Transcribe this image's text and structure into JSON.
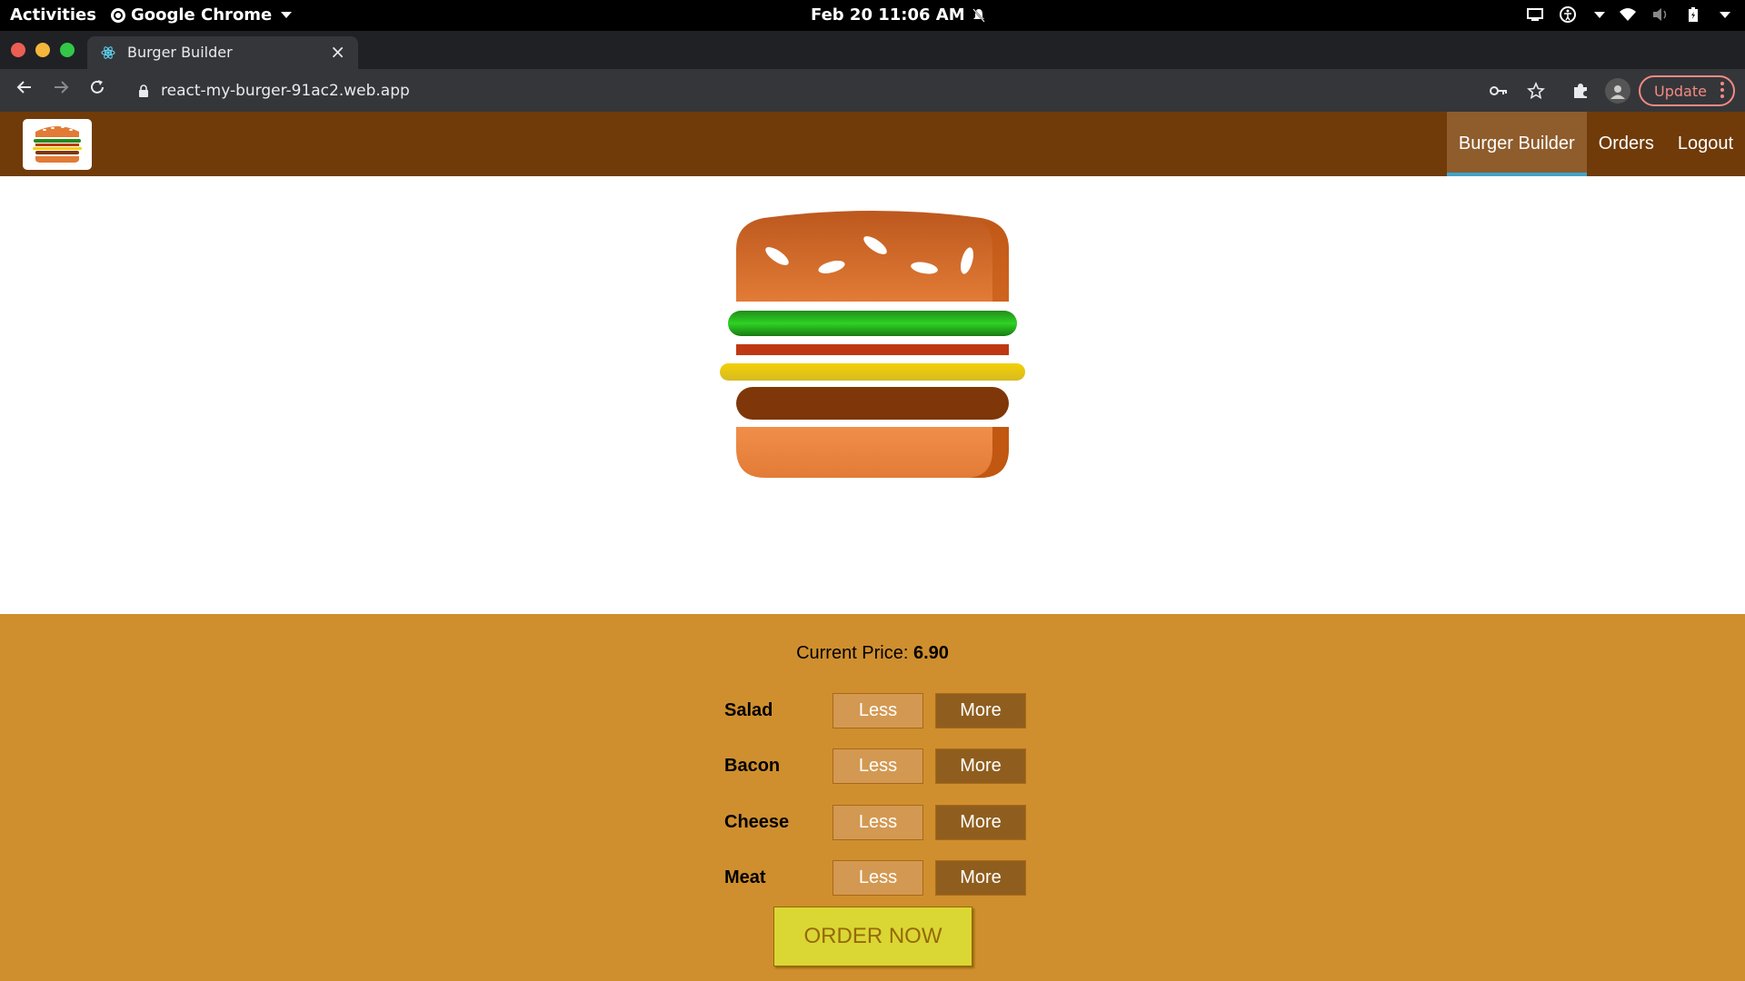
{
  "system_bar": {
    "activities": "Activities",
    "app_name": "Google Chrome",
    "datetime": "Feb 20  11:06 AM"
  },
  "browser": {
    "tab_title": "Burger Builder",
    "new_tab_symbol": "+",
    "close_symbol": "×",
    "url": "react-my-burger-91ac2.web.app",
    "update_label": "Update"
  },
  "app": {
    "nav": {
      "items": [
        {
          "label": "Burger Builder",
          "active": true
        },
        {
          "label": "Orders",
          "active": false
        },
        {
          "label": "Logout",
          "active": false
        }
      ]
    },
    "controls": {
      "price_label": "Current Price:",
      "price_value": "6.90",
      "rows": [
        {
          "label": "Salad",
          "less": "Less",
          "more": "More"
        },
        {
          "label": "Bacon",
          "less": "Less",
          "more": "More"
        },
        {
          "label": "Cheese",
          "less": "Less",
          "more": "More"
        },
        {
          "label": "Meat",
          "less": "Less",
          "more": "More"
        }
      ],
      "order_label": "ORDER NOW"
    },
    "burger_layers": [
      "bread-top",
      "salad",
      "bacon",
      "cheese",
      "meat",
      "bread-bottom"
    ]
  },
  "colors": {
    "header": "#703b09",
    "nav_active": "#8f5c2c",
    "nav_active_border": "#40a4c8",
    "controls_bg": "#cf8f2e",
    "less_button": "#d39952",
    "more_button": "#8f5e1e",
    "order_button": "#dad735",
    "bread": "#e27b36",
    "salad": "#228c1d",
    "bacon": "#bf3813",
    "cheese": "#f4d004",
    "meat": "#7f3608"
  }
}
